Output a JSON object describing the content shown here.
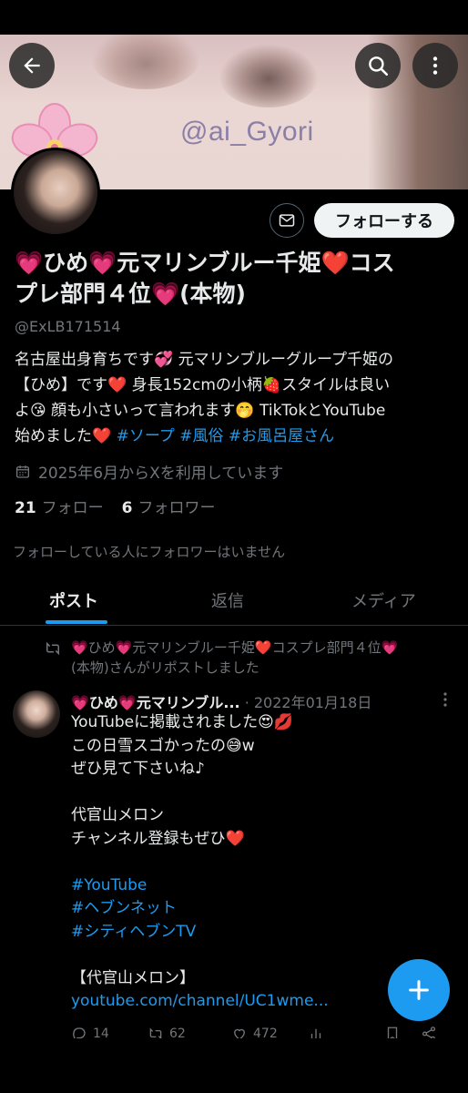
{
  "banner": {
    "watermark": "@ai_Gyori"
  },
  "header": {
    "back_icon": "arrow-left-icon",
    "search_icon": "search-icon",
    "more_icon": "more-vertical-icon"
  },
  "profile": {
    "follow_label": "フォローする",
    "name_line1": "💗ひめ💗元マリンブルー千姫❤️コス",
    "name_line2": "プレ部門４位💗(本物)",
    "handle": "@ExLB171514",
    "bio": {
      "line1": "名古屋出身育ちです💞 元マリンブルーグループ千姫の",
      "line2": "【ひめ】です❤️ 身長152cmの小柄🍓スタイルは良い",
      "line3": "よ😘 顔も小さいって言われます🤭 TikTokとYouTube",
      "line4_text": "始めました❤️ ",
      "tag1": "#ソープ",
      "tag2": "#風俗",
      "tag3": "#お風呂屋さん"
    },
    "joined": "2025年6月からXを利用しています",
    "following_count": "21",
    "following_label": "フォロー",
    "followers_count": "6",
    "followers_label": "フォロワー",
    "no_mutuals": "フォローしている人にフォロワーはいません"
  },
  "tabs": [
    "ポスト",
    "返信",
    "メディア"
  ],
  "post": {
    "repost_line1": "💗ひめ💗元マリンブルー千姫❤️コスプレ部門４位💗",
    "repost_line2": "(本物)さんがリポストしました",
    "author": "💗ひめ💗元マリンブル...",
    "date": "· 2022年01月18日",
    "lines": {
      "l1": "YouTubeに掲載されました😍💋",
      "l2": "この日雪スゴかったの😅w",
      "l3": "ぜひ見て下さいね♪",
      "l4": "代官山メロン",
      "l5": "チャンネル登録もぜひ❤️",
      "h1": "#YouTube",
      "h2": "#ヘブンネット",
      "h3": "#シティヘブンTV",
      "l6": "【代官山メロン】",
      "link": "youtube.com/channel/UC1wme..."
    },
    "replies": "14",
    "reposts": "62",
    "likes": "472"
  },
  "colors": {
    "accent": "#1d9bf0",
    "background": "#000000",
    "secondary_text": "#71767b"
  }
}
